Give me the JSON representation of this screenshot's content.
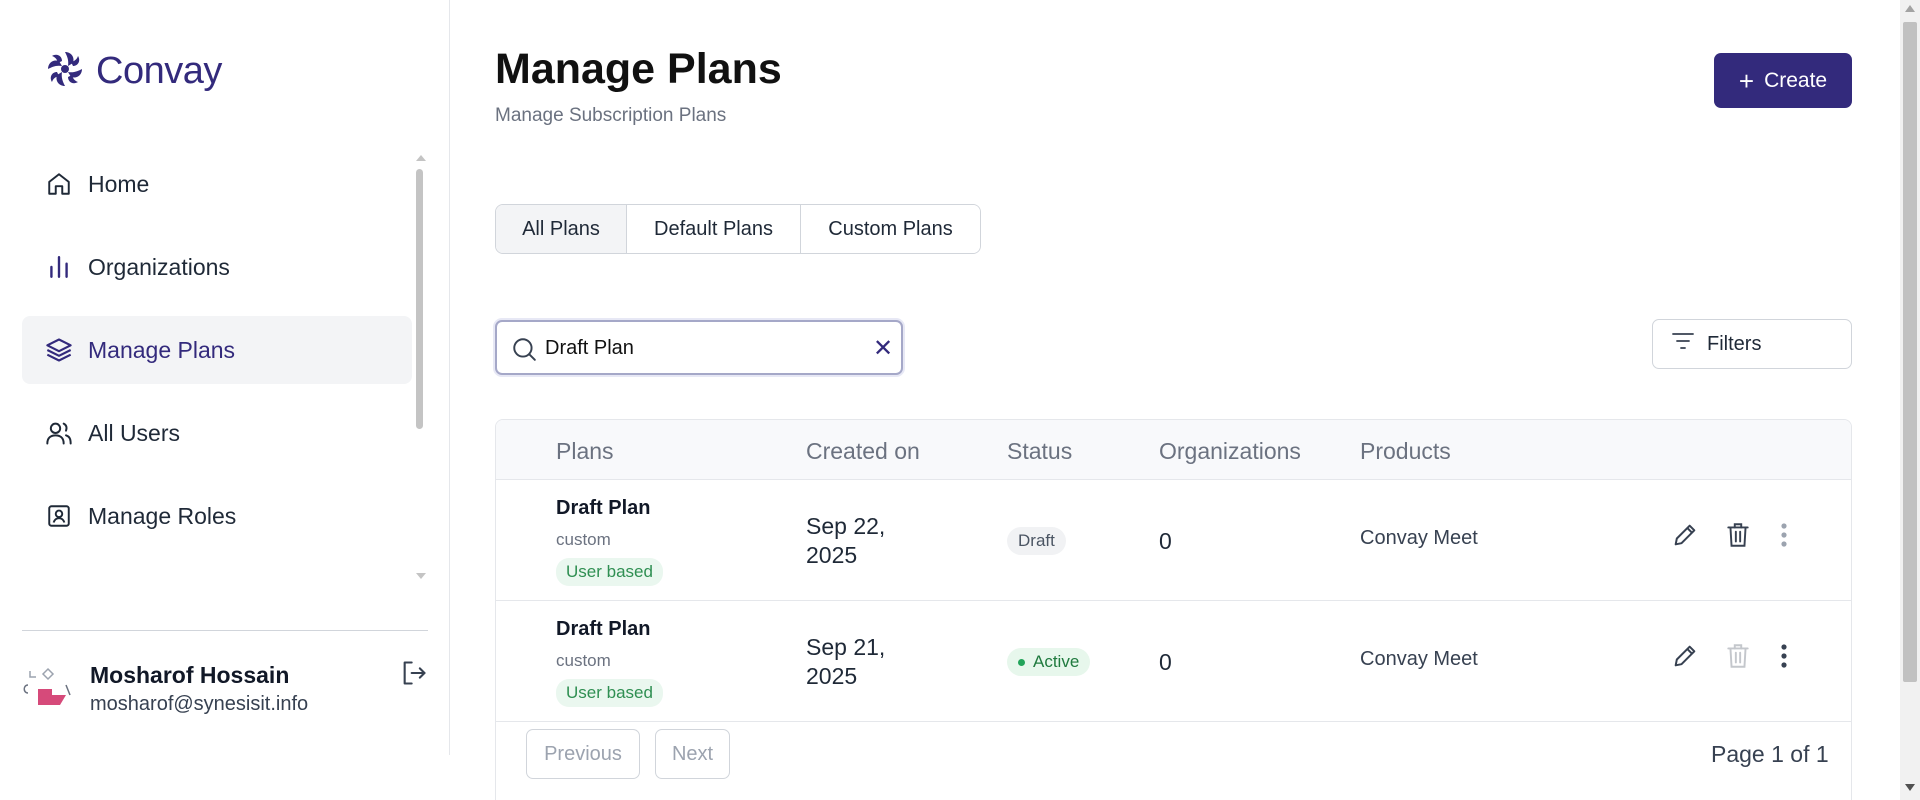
{
  "app": {
    "logo_text": "Convay",
    "brand_color": "#332a7c"
  },
  "sidebar": {
    "items": [
      {
        "label": "Home",
        "icon": "home-icon",
        "active": false
      },
      {
        "label": "Organizations",
        "icon": "bar-chart-icon",
        "active": false
      },
      {
        "label": "Manage Plans",
        "icon": "layers-icon",
        "active": true
      },
      {
        "label": "All Users",
        "icon": "users-icon",
        "active": false
      },
      {
        "label": "Manage Roles",
        "icon": "id-card-icon",
        "active": false
      }
    ],
    "user": {
      "name": "Mosharof Hossain",
      "email": "mosharof@synesisit.info"
    }
  },
  "header": {
    "title": "Manage Plans",
    "subtitle": "Manage Subscription Plans",
    "create_label": "Create"
  },
  "tabs": [
    {
      "label": "All Plans",
      "active": true
    },
    {
      "label": "Default Plans",
      "active": false
    },
    {
      "label": "Custom Plans",
      "active": false
    }
  ],
  "search": {
    "value": "Draft Plan",
    "placeholder": "Search"
  },
  "filters_label": "Filters",
  "table": {
    "columns": [
      "Plans",
      "Created on",
      "Status",
      "Organizations",
      "Products"
    ],
    "rows": [
      {
        "plan": "Draft Plan",
        "type": "custom",
        "badge": "User based",
        "created": "Sep 22, 2025",
        "status": "Draft",
        "organizations": "0",
        "products": "Convay Meet",
        "delete_enabled": true
      },
      {
        "plan": "Draft Plan",
        "type": "custom",
        "badge": "User based",
        "created": "Sep 21, 2025",
        "status": "Active",
        "organizations": "0",
        "products": "Convay Meet",
        "delete_enabled": false
      }
    ]
  },
  "pagination": {
    "previous_label": "Previous",
    "next_label": "Next",
    "page_info": "Page 1 of 1"
  }
}
